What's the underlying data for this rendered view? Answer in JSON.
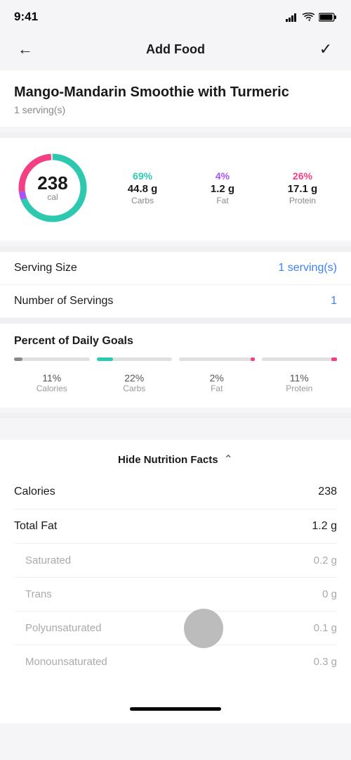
{
  "status": {
    "time": "9:41",
    "signal_bars": [
      3,
      5,
      7,
      9,
      11
    ],
    "wifi": true,
    "battery": true
  },
  "nav": {
    "back_label": "←",
    "title": "Add Food",
    "check_label": "✓"
  },
  "food": {
    "name": "Mango-Mandarin Smoothie with Turmeric",
    "servings_display": "1 serving(s)"
  },
  "donut": {
    "calories": "238",
    "cal_label": "cal",
    "carbs_pct": "69%",
    "carbs_value": "44.8 g",
    "carbs_label": "Carbs",
    "fat_pct": "4%",
    "fat_value": "1.2 g",
    "fat_label": "Fat",
    "protein_pct": "26%",
    "protein_value": "17.1 g",
    "protein_label": "Protein"
  },
  "serving_row": {
    "label": "Serving Size",
    "value": "1 serving(s)"
  },
  "servings_row": {
    "label": "Number of Servings",
    "value": "1"
  },
  "goals": {
    "title": "Percent of Daily Goals",
    "items": [
      {
        "pct": "11%",
        "name": "Calories",
        "fill": 11,
        "type": "cal"
      },
      {
        "pct": "22%",
        "name": "Carbs",
        "fill": 22,
        "type": "carb"
      },
      {
        "pct": "2%",
        "name": "Fat",
        "fill": 2,
        "type": "fat"
      },
      {
        "pct": "11%",
        "name": "Protein",
        "fill": 11,
        "type": "prot"
      }
    ]
  },
  "nutrition_toggle": {
    "label": "Hide Nutrition Facts"
  },
  "nutrition_facts": [
    {
      "label": "Calories",
      "value": "238",
      "sub": false
    },
    {
      "label": "Total Fat",
      "value": "1.2 g",
      "sub": false
    },
    {
      "label": "Saturated",
      "value": "0.2 g",
      "sub": true
    },
    {
      "label": "Trans",
      "value": "0 g",
      "sub": true
    },
    {
      "label": "Polyunsaturated",
      "value": "0.1 g",
      "sub": true
    },
    {
      "label": "Monounsaturated",
      "value": "0.3 g",
      "sub": true
    }
  ]
}
